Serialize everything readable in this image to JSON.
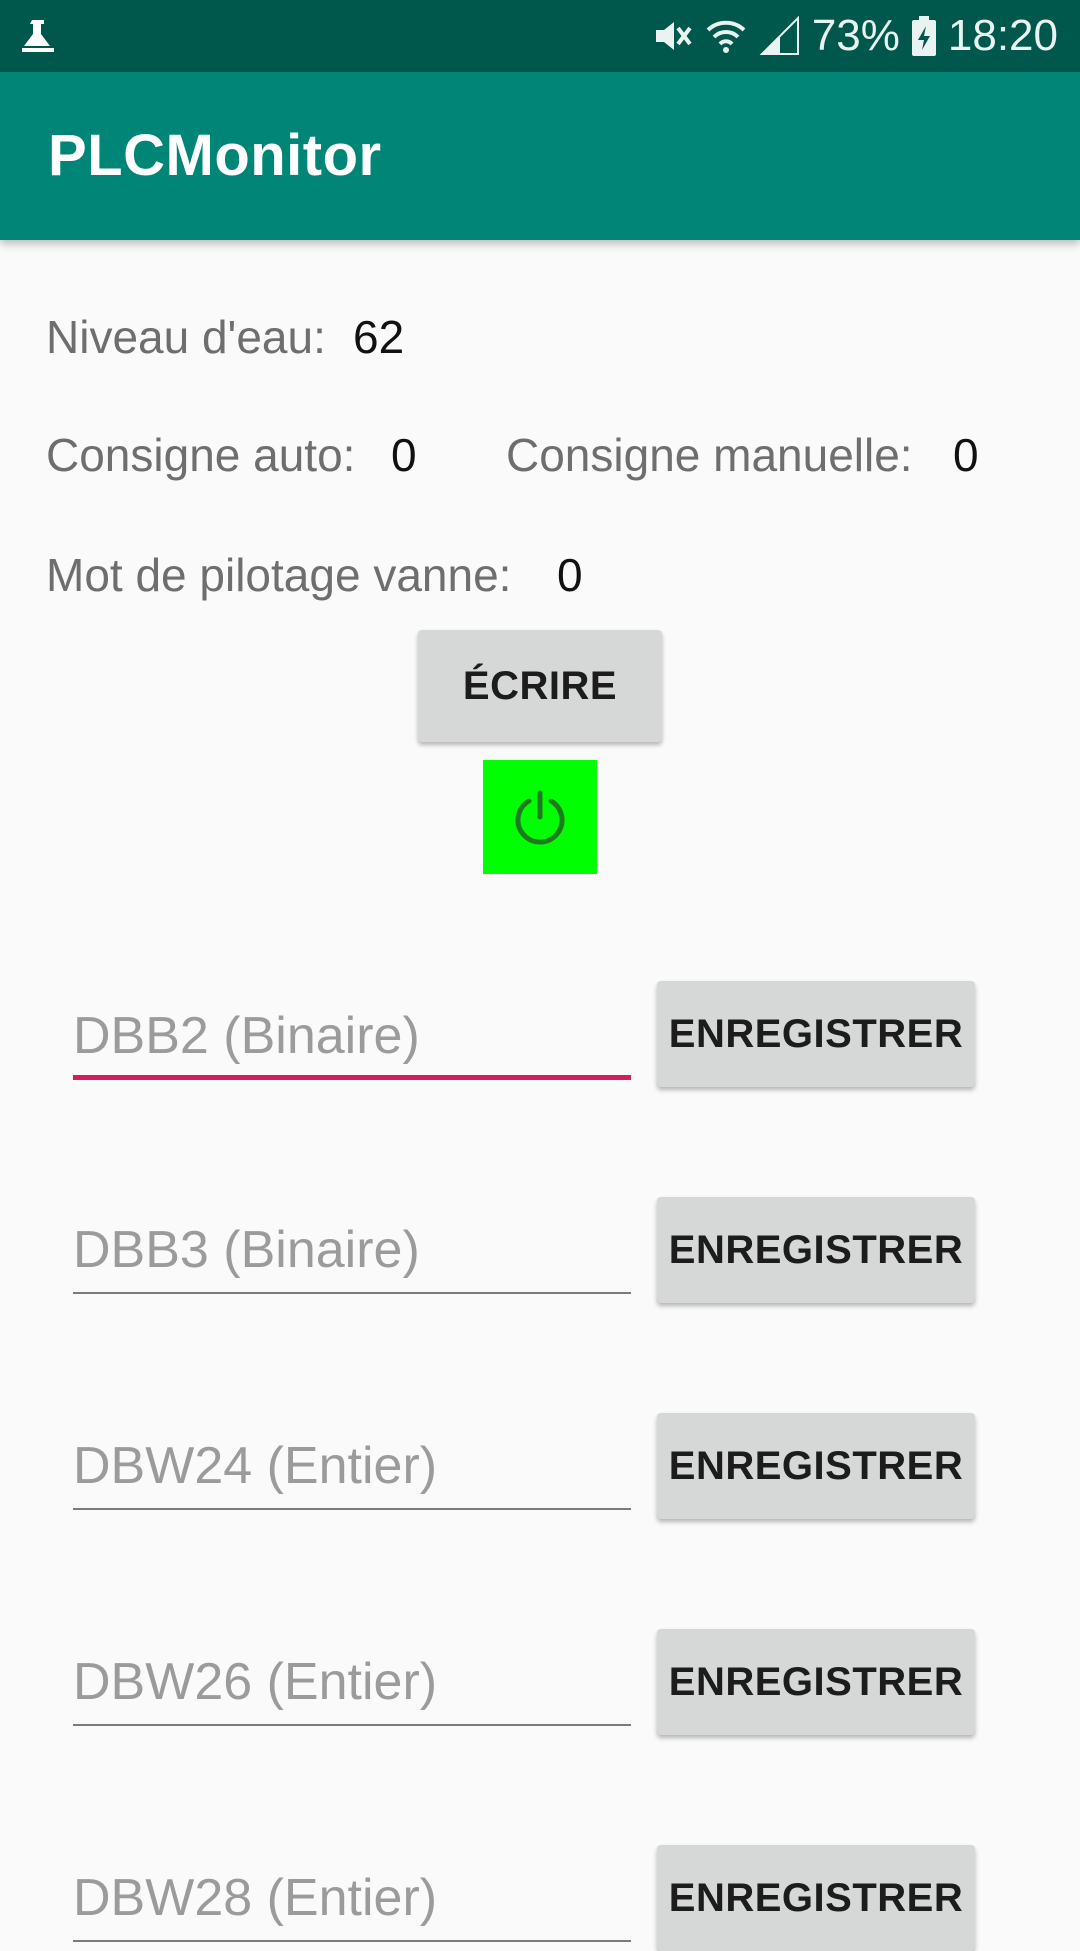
{
  "status_bar": {
    "battery": "73%",
    "time": "18:20"
  },
  "app_bar": {
    "title": "PLCMonitor"
  },
  "readings": {
    "niveau_label": "Niveau d'eau:",
    "niveau_value": "62",
    "consigne_auto_label": "Consigne auto:",
    "consigne_auto_value": "0",
    "consigne_manuelle_label": "Consigne manuelle:",
    "consigne_manuelle_value": "0",
    "mot_pilotage_label": "Mot de pilotage vanne:",
    "mot_pilotage_value": "0"
  },
  "write_button": "ÉCRIRE",
  "power_button": {
    "icon": "power-icon",
    "color": "#00ff00"
  },
  "fields": [
    {
      "placeholder": "DBB2 (Binaire)",
      "value": "",
      "button": "ENREGISTRER",
      "focused": true
    },
    {
      "placeholder": "DBB3 (Binaire)",
      "value": "",
      "button": "ENREGISTRER",
      "focused": false
    },
    {
      "placeholder": "DBW24 (Entier)",
      "value": "",
      "button": "ENREGISTRER",
      "focused": false
    },
    {
      "placeholder": "DBW26 (Entier)",
      "value": "",
      "button": "ENREGISTRER",
      "focused": false
    },
    {
      "placeholder": "DBW28 (Entier)",
      "value": "",
      "button": "ENREGISTRER",
      "focused": false
    }
  ],
  "colors": {
    "status_bar": "#00574b",
    "app_bar": "#008577",
    "accent": "#d81b60",
    "button": "#d6d7d7"
  }
}
